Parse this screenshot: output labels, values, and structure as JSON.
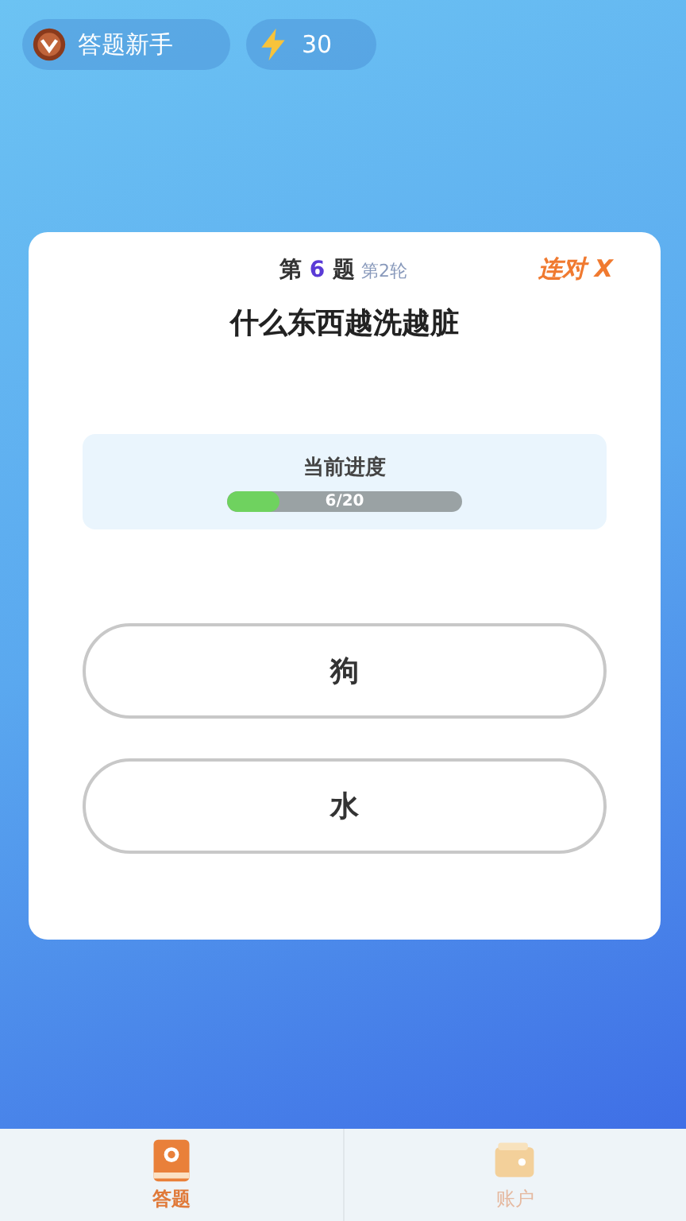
{
  "status": {
    "rank": "答题新手",
    "energy": "30"
  },
  "question": {
    "prefix": "第",
    "number": "6",
    "suffix": "题",
    "round": "第2轮",
    "streak": "连对 X",
    "text": "什么东西越洗越脏"
  },
  "progress": {
    "label": "当前进度",
    "reading": "6/20",
    "level": 0.22
  },
  "answers": [
    "狗",
    "水"
  ],
  "tabs": [
    {
      "label": "答题",
      "selected": true,
      "kind": "book"
    },
    {
      "label": "账户",
      "selected": false,
      "kind": "wallet"
    }
  ]
}
